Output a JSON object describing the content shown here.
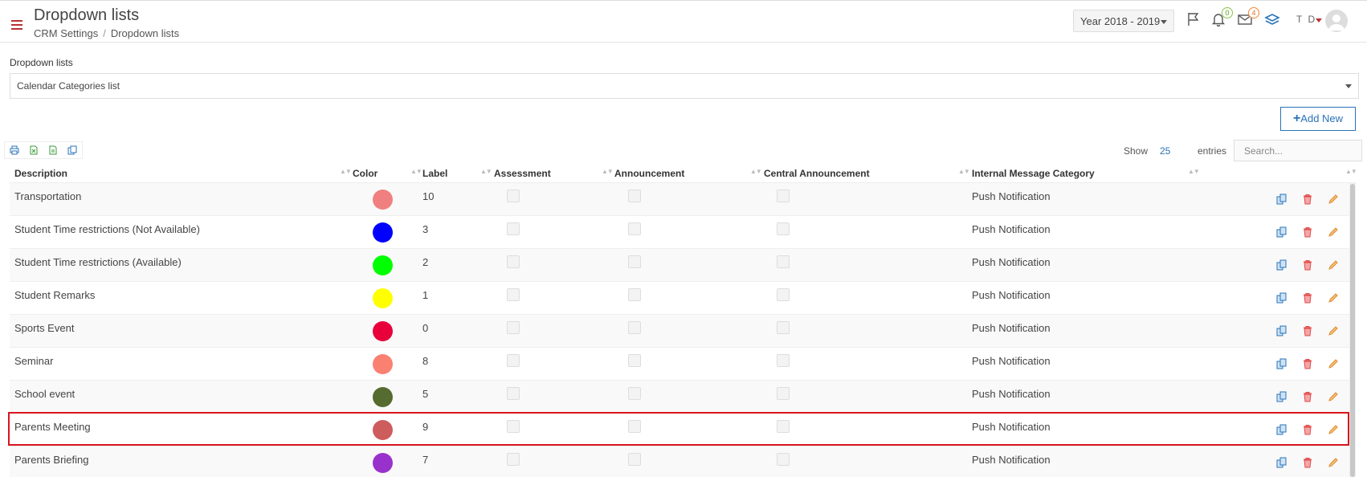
{
  "header": {
    "title": "Dropdown lists",
    "breadcrumb": [
      "CRM Settings",
      "Dropdown lists"
    ],
    "year_select": "Year 2018 - 2019",
    "notifications_count": "0",
    "messages_count": "4",
    "user_initials": "T D"
  },
  "form": {
    "section_label": "Dropdown lists",
    "selected_list": "Calendar Categories list",
    "add_button": "Add New"
  },
  "table_controls": {
    "show_label": "Show",
    "page_size": "25",
    "entries_label": "entries",
    "search_placeholder": "Search..."
  },
  "columns": [
    "Description",
    "Color",
    "Label",
    "Assessment",
    "Announcement",
    "Central Announcement",
    "Internal Message Category"
  ],
  "rows": [
    {
      "description": "Transportation",
      "color": "#f08080",
      "label": "10",
      "category": "Push Notification"
    },
    {
      "description": "Student Time restrictions (Not Available)",
      "color": "#0000ff",
      "label": "3",
      "category": "Push Notification"
    },
    {
      "description": "Student Time restrictions (Available)",
      "color": "#00ff00",
      "label": "2",
      "category": "Push Notification"
    },
    {
      "description": "Student Remarks",
      "color": "#ffff00",
      "label": "1",
      "category": "Push Notification"
    },
    {
      "description": "Sports Event",
      "color": "#e8003a",
      "label": "0",
      "category": "Push Notification"
    },
    {
      "description": "Seminar",
      "color": "#fa8072",
      "label": "8",
      "category": "Push Notification"
    },
    {
      "description": "School event",
      "color": "#556b2f",
      "label": "5",
      "category": "Push Notification"
    },
    {
      "description": "Parents Meeting",
      "color": "#cd5c5c",
      "label": "9",
      "category": "Push Notification"
    },
    {
      "description": "Parents Briefing",
      "color": "#9932cc",
      "label": "7",
      "category": "Push Notification"
    }
  ],
  "highlighted_row": "Parents Meeting",
  "icons": {
    "menu": "hamburger-menu-icon",
    "flag": "flag-icon",
    "bell": "bell-icon",
    "mail": "mail-icon",
    "layers": "layers-icon",
    "print": "print-icon",
    "excel": "excel-icon",
    "csv": "csv-icon",
    "copy": "copy-icon",
    "row_copy": "copy-icon",
    "row_delete": "trash-icon",
    "row_edit": "pencil-icon"
  },
  "colors": {
    "accent": "#b83236",
    "primary": "#2a73b8",
    "highlight_border": "#d8161e"
  }
}
